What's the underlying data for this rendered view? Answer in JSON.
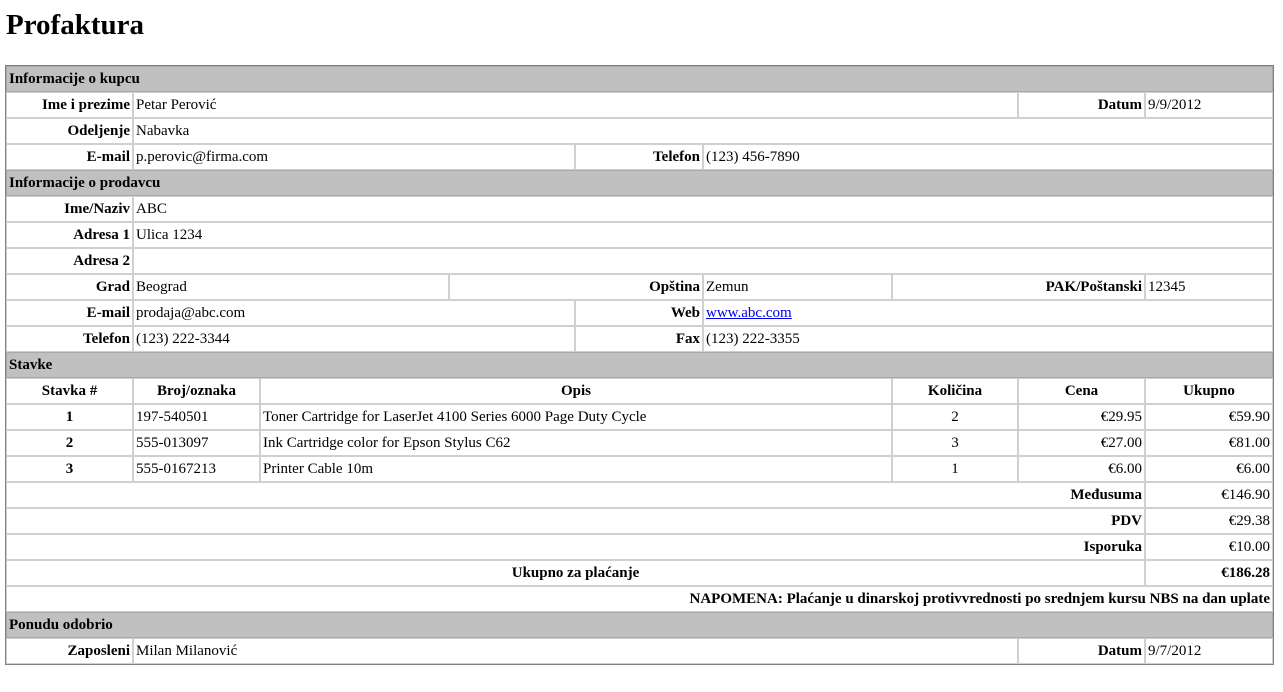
{
  "title": "Profaktura",
  "buyer": {
    "section": "Informacije o kupcu",
    "name_label": "Ime i prezime",
    "name": "Petar Perović",
    "date_label": "Datum",
    "date": "9/9/2012",
    "dept_label": "Odeljenje",
    "dept": "Nabavka",
    "email_label": "E-mail",
    "email": "p.perovic@firma.com",
    "phone_label": "Telefon",
    "phone": "(123) 456-7890"
  },
  "seller": {
    "section": "Informacije o prodavcu",
    "name_label": "Ime/Naziv",
    "name": "ABC",
    "addr1_label": "Adresa 1",
    "addr1": "Ulica 1234",
    "addr2_label": "Adresa 2",
    "addr2": "",
    "city_label": "Grad",
    "city": "Beograd",
    "municipality_label": "Opština",
    "municipality": "Zemun",
    "zip_label": "PAK/Poštanski",
    "zip": "12345",
    "email_label": "E-mail",
    "email": "prodaja@abc.com",
    "web_label": "Web",
    "web": "www.abc.com",
    "phone_label": "Telefon",
    "phone": "(123) 222-3344",
    "fax_label": "Fax",
    "fax": "(123) 222-3355"
  },
  "items": {
    "section": "Stavke",
    "headers": [
      "Stavka #",
      "Broj/oznaka",
      "Opis",
      "Količina",
      "Cena",
      "Ukupno"
    ],
    "rows": [
      {
        "num": "1",
        "code": "197-540501",
        "desc": "Toner Cartridge for LaserJet 4100 Series 6000 Page Duty Cycle",
        "qty": "2",
        "price": "€29.95",
        "total": "€59.90"
      },
      {
        "num": "2",
        "code": "555-013097",
        "desc": "Ink Cartridge color for Epson Stylus C62",
        "qty": "3",
        "price": "€27.00",
        "total": "€81.00"
      },
      {
        "num": "3",
        "code": "555-0167213",
        "desc": "Printer Cable 10m",
        "qty": "1",
        "price": "€6.00",
        "total": "€6.00"
      }
    ]
  },
  "totals": {
    "subtotal_label": "Međusuma",
    "subtotal": "€146.90",
    "vat_label": "PDV",
    "vat": "€29.38",
    "shipping_label": "Isporuka",
    "shipping": "€10.00",
    "grand_label": "Ukupno za plaćanje",
    "grand": "€186.28",
    "note": "NAPOMENA: Plaćanje u dinarskoj protivvrednosti po srednjem kursu NBS na dan uplate"
  },
  "approval": {
    "section": "Ponudu odobrio",
    "employee_label": "Zaposleni",
    "employee": "Milan Milanović",
    "date_label": "Datum",
    "date": "9/7/2012"
  }
}
